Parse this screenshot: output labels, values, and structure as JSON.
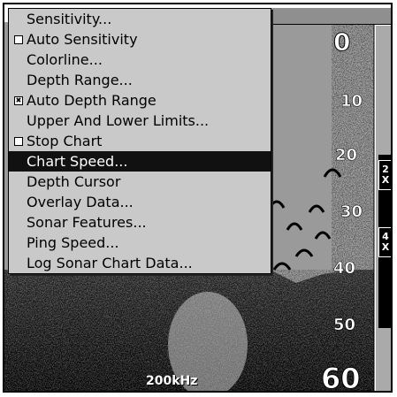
{
  "menu": {
    "items": [
      {
        "label": "Sensitivity...",
        "checkbox": null,
        "selected": false,
        "name": "menu-item-sensitivity"
      },
      {
        "label": "Auto Sensitivity",
        "checkbox": false,
        "selected": false,
        "name": "menu-item-auto-sensitivity"
      },
      {
        "label": "Colorline...",
        "checkbox": null,
        "selected": false,
        "name": "menu-item-colorline"
      },
      {
        "label": "Depth Range...",
        "checkbox": null,
        "selected": false,
        "name": "menu-item-depth-range"
      },
      {
        "label": "Auto Depth Range",
        "checkbox": true,
        "selected": false,
        "name": "menu-item-auto-depth-range"
      },
      {
        "label": "Upper And Lower Limits...",
        "checkbox": null,
        "selected": false,
        "name": "menu-item-upper-lower-limits"
      },
      {
        "label": "Stop Chart",
        "checkbox": false,
        "selected": false,
        "name": "menu-item-stop-chart"
      },
      {
        "label": "Chart Speed...",
        "checkbox": null,
        "selected": true,
        "name": "menu-item-chart-speed"
      },
      {
        "label": "Depth Cursor",
        "checkbox": null,
        "selected": false,
        "name": "menu-item-depth-cursor"
      },
      {
        "label": "Overlay Data...",
        "checkbox": null,
        "selected": false,
        "name": "menu-item-overlay-data"
      },
      {
        "label": "Sonar Features...",
        "checkbox": null,
        "selected": false,
        "name": "menu-item-sonar-features"
      },
      {
        "label": "Ping Speed...",
        "checkbox": null,
        "selected": false,
        "name": "menu-item-ping-speed"
      },
      {
        "label": "Log Sonar Chart Data...",
        "checkbox": null,
        "selected": false,
        "name": "menu-item-log-sonar-chart-data"
      }
    ]
  },
  "depth_scale": {
    "labels": [
      "0",
      "10",
      "20",
      "30",
      "40",
      "50",
      "60"
    ]
  },
  "zoom": {
    "labels": [
      "2X",
      "4X"
    ]
  },
  "sonar": {
    "frequency": "200kHz"
  },
  "colors": {
    "menu_bg": "#c9c9c9",
    "selected_bg": "#111111",
    "sonar_bg": "#9a9a9a"
  }
}
